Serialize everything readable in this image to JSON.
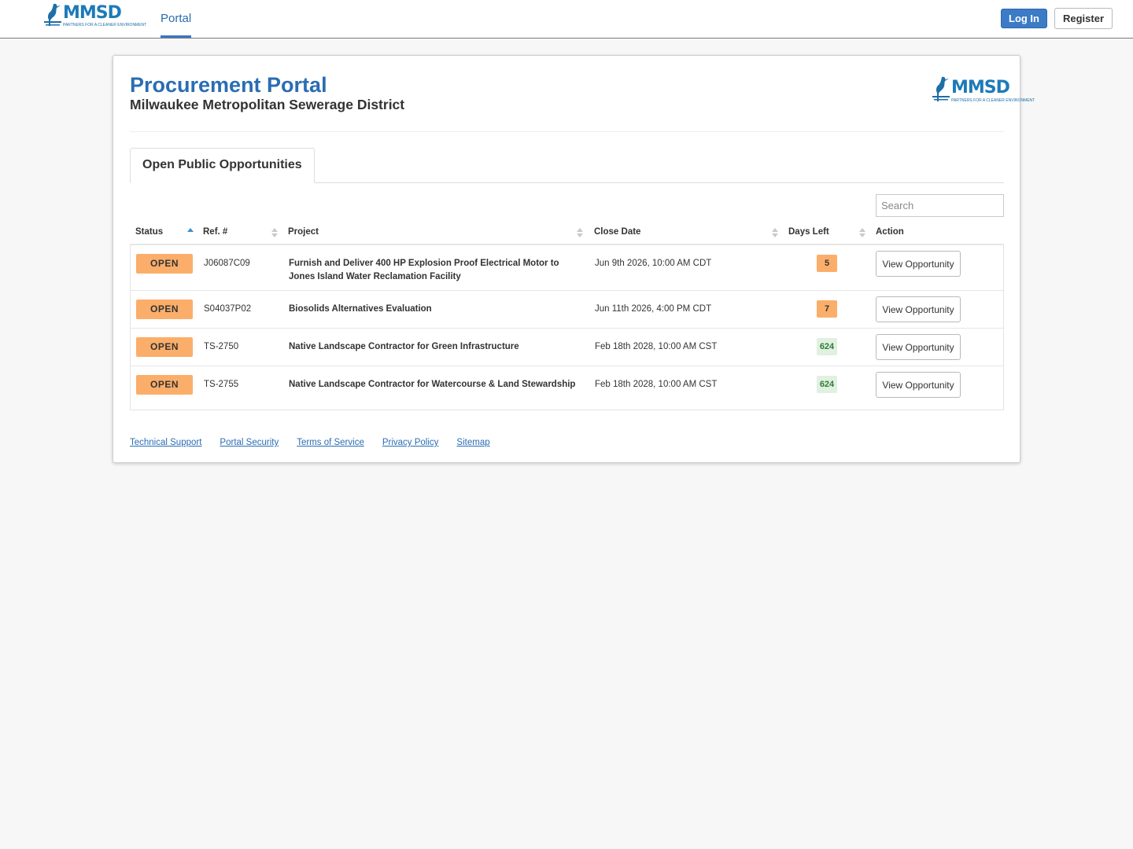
{
  "nav": {
    "logo_text": "MMSD",
    "logo_tagline": "PARTNERS FOR A CLEANER ENVIRONMENT",
    "portal_link": "Portal",
    "login_label": "Log In",
    "register_label": "Register"
  },
  "header": {
    "title": "Procurement Portal",
    "subtitle": "Milwaukee Metropolitan Sewerage District"
  },
  "tab": {
    "label": "Open Public Opportunities"
  },
  "search": {
    "placeholder": "Search"
  },
  "table": {
    "columns": [
      "Status",
      "Ref. #",
      "Project",
      "Close Date",
      "Days Left",
      "Action"
    ],
    "sorted_column": "Status",
    "rows": [
      {
        "status": "OPEN",
        "ref": "J06087C09",
        "project": "Furnish and Deliver 400 HP Explosion Proof Electrical Motor to Jones Island Water Reclamation Facility",
        "close_date": "Jun 9th 2026, 10:00 AM CDT",
        "days_left": "5",
        "action": "View Opportunity"
      },
      {
        "status": "OPEN",
        "ref": "S04037P02",
        "project": "Biosolids Alternatives Evaluation",
        "close_date": "Jun 11th 2026, 4:00 PM CDT",
        "days_left": "7",
        "action": "View Opportunity"
      },
      {
        "status": "OPEN",
        "ref": "TS-2750",
        "project": "Native Landscape Contractor for Green Infrastructure",
        "close_date": "Feb 18th 2028, 10:00 AM CST",
        "days_left": "624",
        "action": "View Opportunity"
      },
      {
        "status": "OPEN",
        "ref": "TS-2755",
        "project": "Native Landscape Contractor for Watercourse & Land Stewardship",
        "close_date": "Feb 18th 2028, 10:00 AM CST",
        "days_left": "624",
        "action": "View Opportunity"
      }
    ]
  },
  "footer": {
    "links": [
      "Technical Support",
      "Portal Security",
      "Terms of Service",
      "Privacy Policy",
      "Sitemap"
    ]
  },
  "colors": {
    "primary_blue": "#2a6db3",
    "open_badge": "#fbae6a",
    "days_ok_bg": "#e1f0e1",
    "days_ok_text": "#2e7d32"
  }
}
